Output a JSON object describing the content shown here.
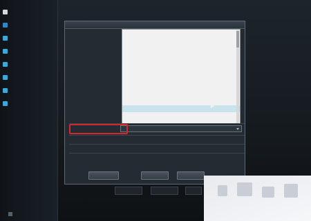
{
  "sidebar": {
    "items": [
      {
        "label": "",
        "icon": "display-icon",
        "color": "#d6d9dc"
      },
      {
        "label": "",
        "icon": "image-icon",
        "color": "#2f88c8"
      },
      {
        "label": "",
        "icon": "record-icon",
        "color": "#3ea9d8"
      },
      {
        "label": "",
        "icon": "network-icon",
        "color": "#3ea9d8"
      },
      {
        "label": "",
        "icon": "hdd-icon",
        "color": "#3ea9d8"
      },
      {
        "label": "",
        "icon": "alarm-icon",
        "color": "#3ea9d8"
      },
      {
        "label": "",
        "icon": "system-icon",
        "color": "#3ea9d8"
      },
      {
        "label": "",
        "icon": "smart-icon",
        "color": "#3ea9d8"
      }
    ]
  },
  "topbar": {
    "items": [
      "",
      "",
      "",
      "",
      "",
      "",
      "",
      "",
      ""
    ]
  },
  "dialog": {
    "title": "",
    "col_headers": [
      "",
      ""
    ]
  },
  "dropdown": {
    "items": [
      "",
      "",
      "",
      "",
      "",
      "",
      "",
      "",
      "",
      "",
      "",
      "",
      "",
      ""
    ],
    "selected_index": 11
  },
  "annotation": "",
  "form": {
    "rows": [
      {
        "label": "",
        "value": ""
      },
      {
        "label": "",
        "value": ""
      },
      {
        "label": "",
        "value": ""
      },
      {
        "label": "",
        "value": ""
      },
      {
        "label": "",
        "value": ""
      }
    ]
  },
  "buttons": {
    "manage": "",
    "ok": "",
    "cancel": ""
  },
  "sub_buttons": [
    "",
    "",
    ""
  ],
  "footer": {
    "left": "",
    "text": ""
  },
  "colors": {
    "accent": "#3ea9d8",
    "highlight": "#d9262c",
    "annotation": "#e0303a"
  }
}
